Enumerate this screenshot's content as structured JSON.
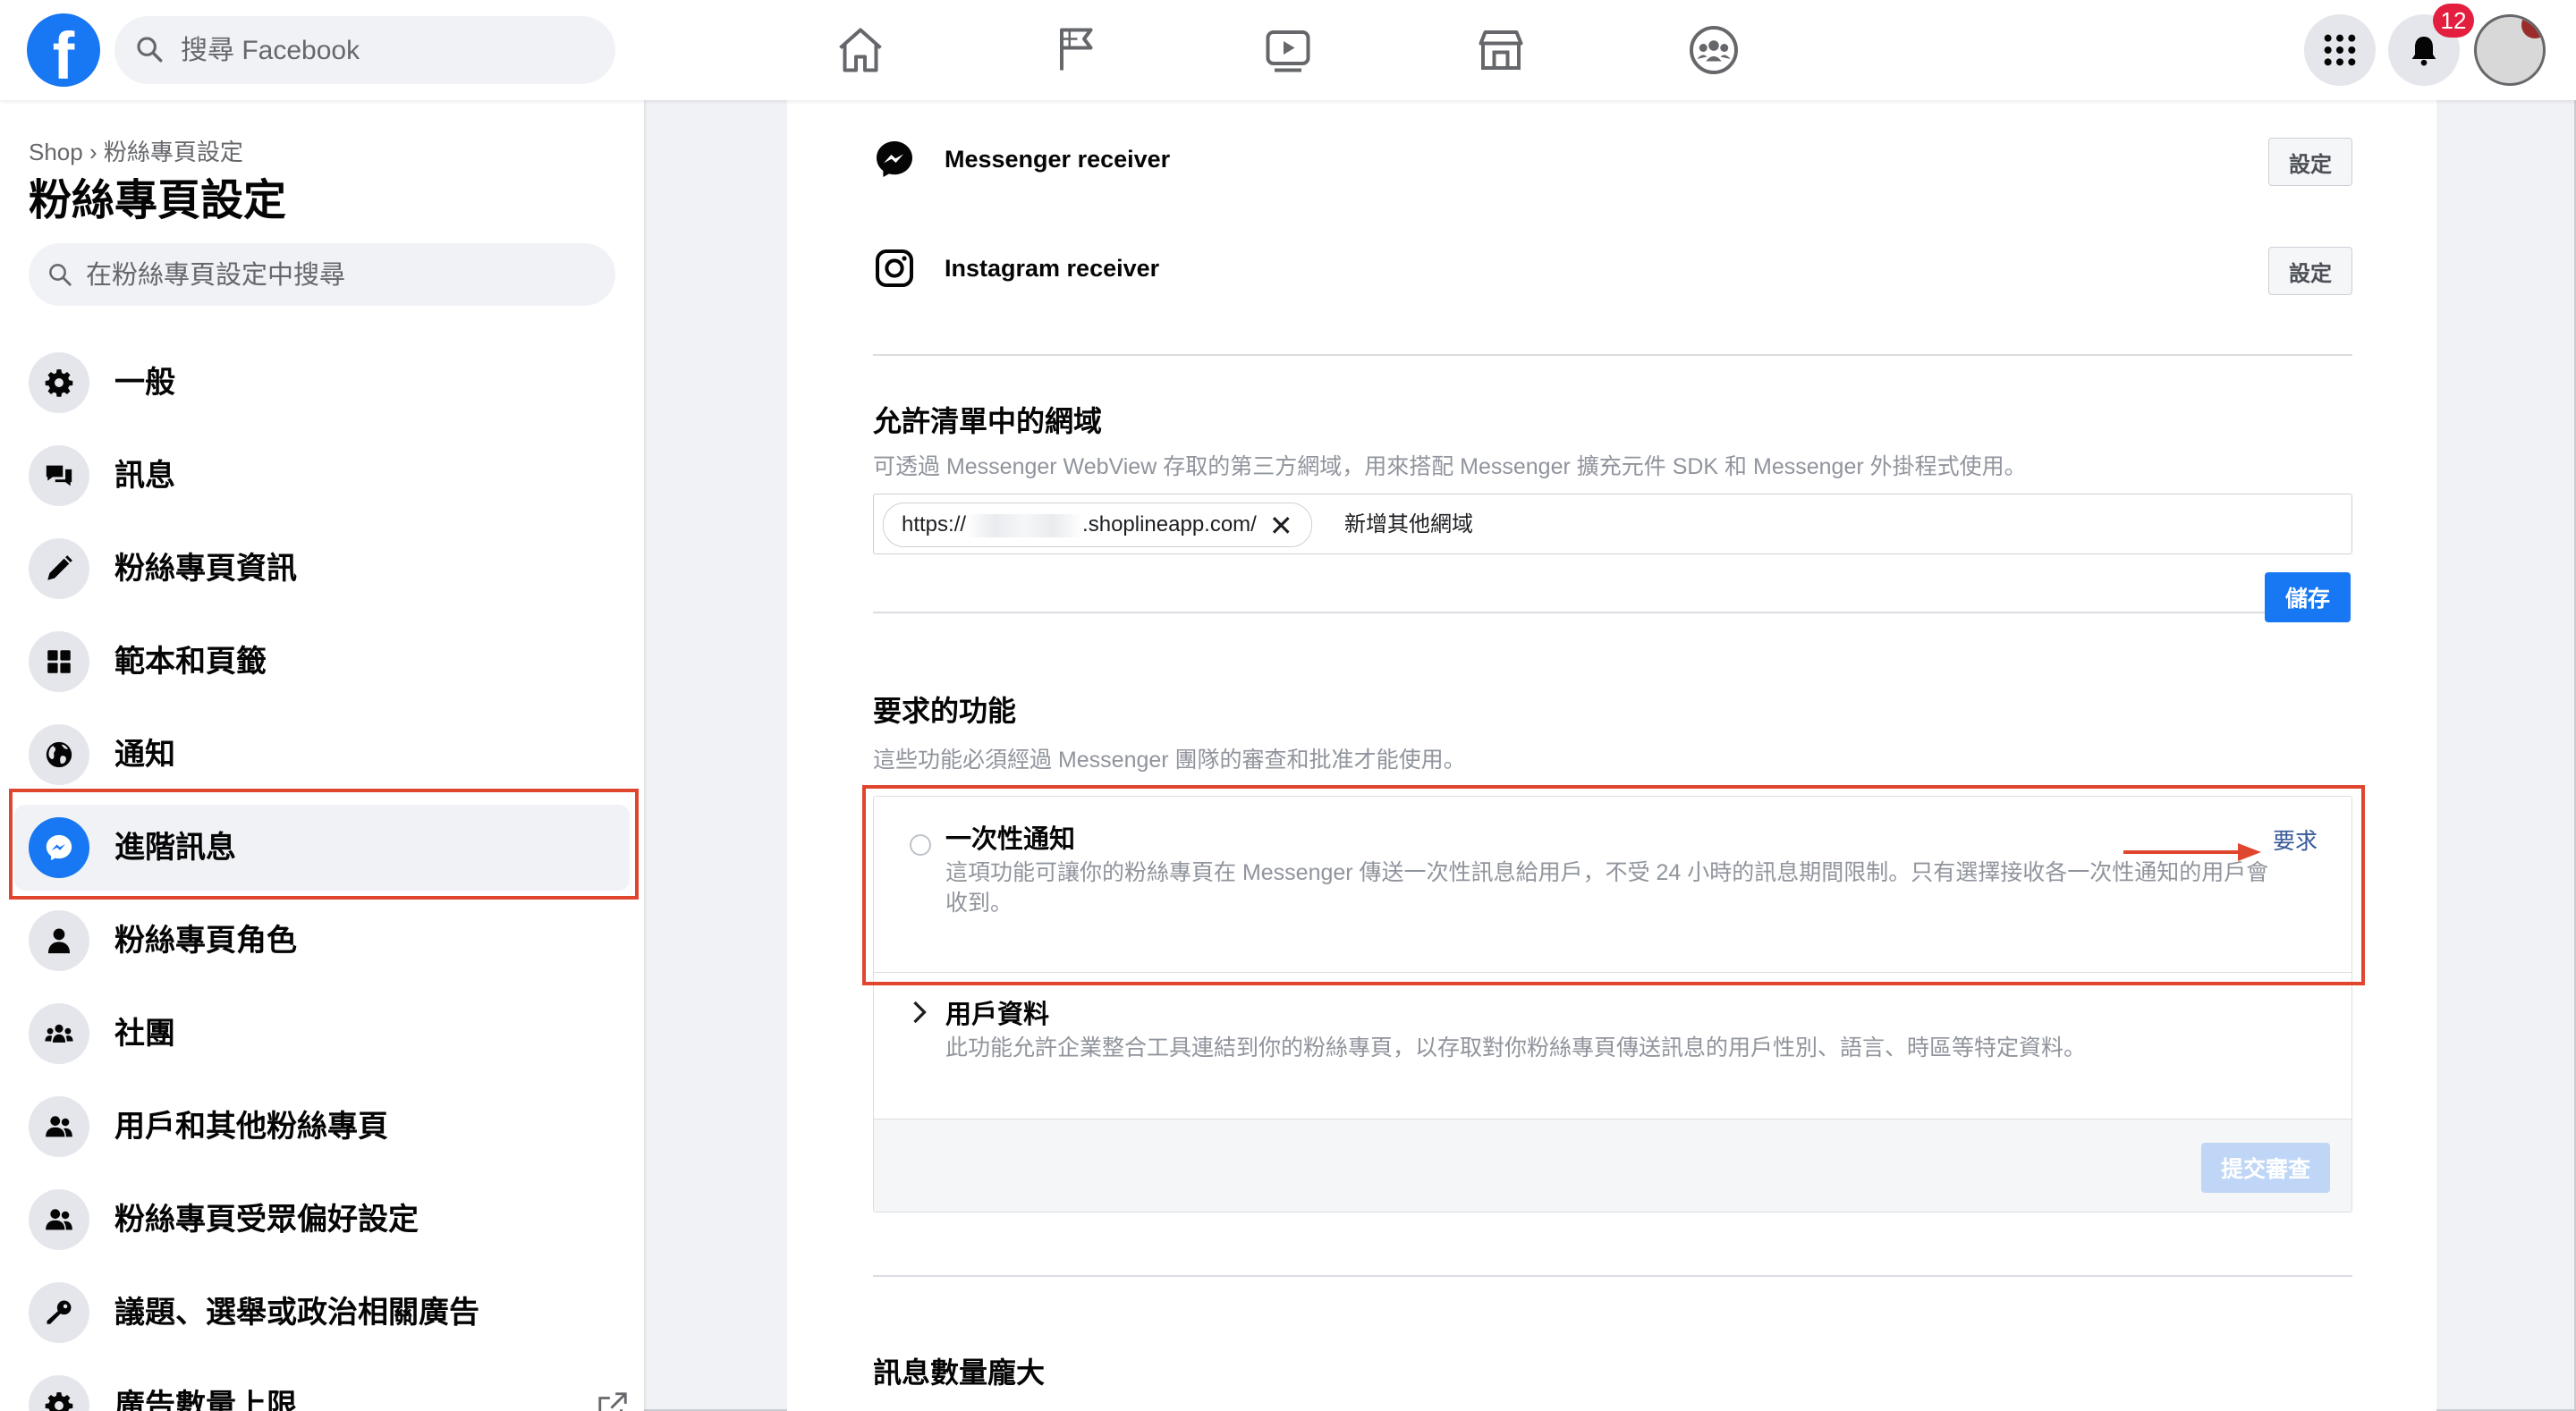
{
  "topbar": {
    "search_placeholder": "搜尋 Facebook",
    "notification_count": "12",
    "nav_icons": [
      "home-icon",
      "flag-icon",
      "watch-icon",
      "marketplace-icon",
      "groups-icon"
    ],
    "accent": "#1877f2"
  },
  "sidebar": {
    "breadcrumb": "Shop › 粉絲專頁設定",
    "title": "粉絲專頁設定",
    "search_placeholder": "在粉絲專頁設定中搜尋",
    "items": [
      {
        "label": "一般",
        "icon": "gear-icon"
      },
      {
        "label": "訊息",
        "icon": "chat-icon"
      },
      {
        "label": "粉絲專頁資訊",
        "icon": "pencil-icon"
      },
      {
        "label": "範本和頁籤",
        "icon": "grid-icon"
      },
      {
        "label": "通知",
        "icon": "globe-icon"
      },
      {
        "label": "進階訊息",
        "icon": "messenger-icon",
        "active": true
      },
      {
        "label": "粉絲專頁角色",
        "icon": "person-icon"
      },
      {
        "label": "社團",
        "icon": "group-icon"
      },
      {
        "label": "用戶和其他粉絲專頁",
        "icon": "people-icon"
      },
      {
        "label": "粉絲專頁受眾偏好設定",
        "icon": "people-icon"
      },
      {
        "label": "議題、選舉或政治相關廣告",
        "icon": "key-icon"
      },
      {
        "label": "廣告數量上限",
        "icon": "gear-icon"
      }
    ]
  },
  "main": {
    "receivers": [
      {
        "name": "Messenger receiver",
        "button": "設定",
        "icon": "messenger-icon"
      },
      {
        "name": "Instagram receiver",
        "button": "設定",
        "icon": "instagram-icon"
      }
    ],
    "whitelist": {
      "title": "允許清單中的網域",
      "description": "可透過 Messenger WebView 存取的第三方網域，用來搭配 Messenger 擴充元件 SDK 和 Messenger 外掛程式使用。",
      "chip_prefix": "https://",
      "chip_suffix": ".shoplineapp.com/",
      "chip_remove": "✕",
      "input_placeholder": "新增其他網域",
      "save_label": "儲存"
    },
    "features": {
      "title": "要求的功能",
      "description": "這些功能必須經過 Messenger 團隊的審查和批准才能使用。",
      "items": [
        {
          "name": "一次性通知",
          "description": "這項功能可讓你的粉絲專頁在 Messenger 傳送一次性訊息給用戶，不受 24 小時的訊息期間限制。只有選擇接收各一次性通知的用戶會收到。",
          "action": "要求"
        },
        {
          "name": "用戶資料",
          "description": "此功能允許企業整合工具連結到你的粉絲專頁，以存取對你粉絲專頁傳送訊息的用戶性別、語言、時區等特定資料。"
        }
      ],
      "submit_label": "提交審查"
    },
    "next_section_title": "訊息數量龐大"
  },
  "highlight_color": "#e0452e"
}
